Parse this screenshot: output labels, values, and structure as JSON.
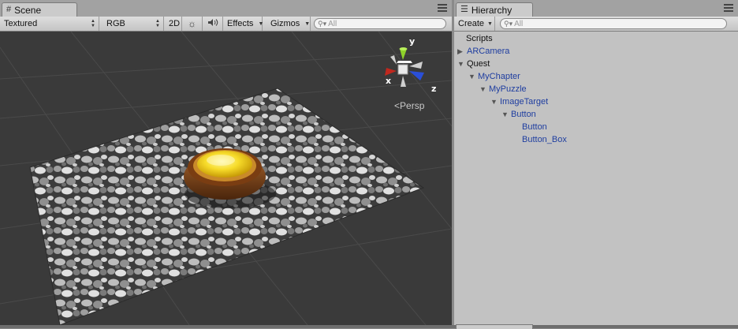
{
  "scene": {
    "tab_title": "Scene",
    "tab_icon": "#",
    "toolbar": {
      "render_mode": "Textured",
      "color_mode": "RGB",
      "mode_2d": "2D",
      "effects": "Effects",
      "gizmos": "Gizmos",
      "search_placeholder": "All"
    },
    "gizmo": {
      "x_label": "x",
      "y_label": "y",
      "z_label": "z",
      "projection": "Persp"
    }
  },
  "hierarchy": {
    "tab_title": "Hierarchy",
    "create_label": "Create",
    "search_placeholder": "All",
    "items": [
      {
        "label": "Scripts",
        "expanded": null,
        "color": "black"
      },
      {
        "label": "ARCamera",
        "expanded": false,
        "color": "blue"
      },
      {
        "label": "Quest",
        "expanded": true,
        "color": "black"
      },
      {
        "label": "MyChapter",
        "expanded": true,
        "color": "blue"
      },
      {
        "label": "MyPuzzle",
        "expanded": true,
        "color": "blue"
      },
      {
        "label": "ImageTarget",
        "expanded": true,
        "color": "blue"
      },
      {
        "label": "Button",
        "expanded": true,
        "color": "blue"
      },
      {
        "label": "Button",
        "expanded": null,
        "color": "blue"
      },
      {
        "label": "Button_Box",
        "expanded": null,
        "color": "blue"
      }
    ]
  },
  "colors": {
    "viewport_bg": "#3a3a3a",
    "tree_blue": "#1f3ea0",
    "gizmo_x": "#c0281e",
    "gizmo_y": "#8ed12a",
    "gizmo_z": "#2a4fd8"
  },
  "icons": [
    "grid-icon",
    "menu-icon",
    "sun-icon",
    "speaker-icon",
    "search-icon",
    "dropdown-icon",
    "expand-triangle-icon",
    "collapse-triangle-icon"
  ]
}
